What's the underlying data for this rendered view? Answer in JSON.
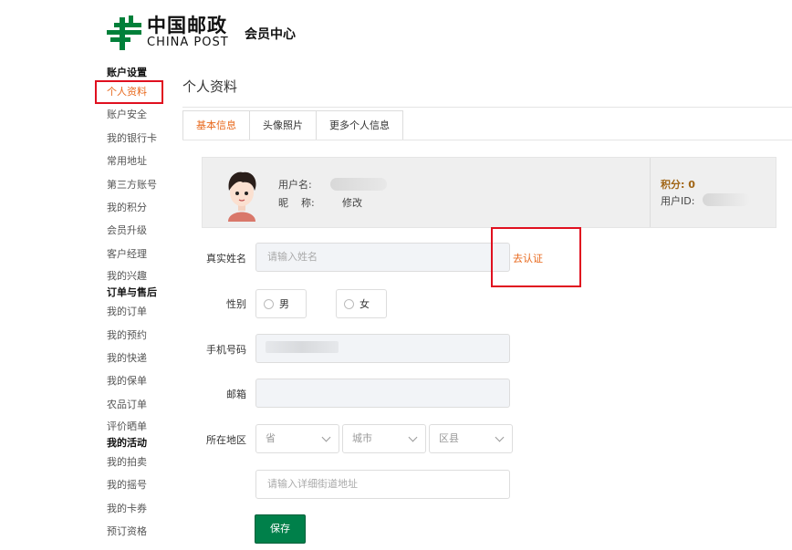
{
  "header": {
    "logo_cn": "中国邮政",
    "logo_en": "CHINA POST",
    "title": "会员中心"
  },
  "sidebar": {
    "groups": [
      {
        "title": "账户设置",
        "items": [
          "个人资料",
          "账户安全",
          "我的银行卡",
          "常用地址",
          "第三方账号",
          "我的积分",
          "会员升级",
          "客户经理",
          "我的兴趣"
        ]
      },
      {
        "title": "订单与售后",
        "items": [
          "我的订单",
          "我的预约",
          "我的快递",
          "我的保单",
          "农品订单",
          "评价晒单"
        ]
      },
      {
        "title": "我的活动",
        "items": [
          "我的拍卖",
          "我的摇号",
          "我的卡券",
          "预订资格"
        ]
      }
    ]
  },
  "main": {
    "title": "个人资料",
    "tabs": [
      "基本信息",
      "头像照片",
      "更多个人信息"
    ],
    "profile": {
      "username_label": "用户名:",
      "nickname_label": "昵    称:",
      "nickname_edit": "修改",
      "points_label": "积分:",
      "points_value": "0",
      "userid_label": "用户ID:"
    },
    "form": {
      "realname_label": "真实姓名",
      "realname_placeholder": "请输入姓名",
      "verify_link": "去认证",
      "gender_label": "性别",
      "gender_male": "男",
      "gender_female": "女",
      "phone_label": "手机号码",
      "email_label": "邮箱",
      "region_label": "所在地区",
      "province": "省",
      "city": "城市",
      "district": "区县",
      "address_placeholder": "请输入详细街道地址",
      "save": "保存"
    }
  },
  "colors": {
    "brand_green": "#00803a",
    "accent_orange": "#e8691d",
    "highlight_red": "#e0101f"
  }
}
